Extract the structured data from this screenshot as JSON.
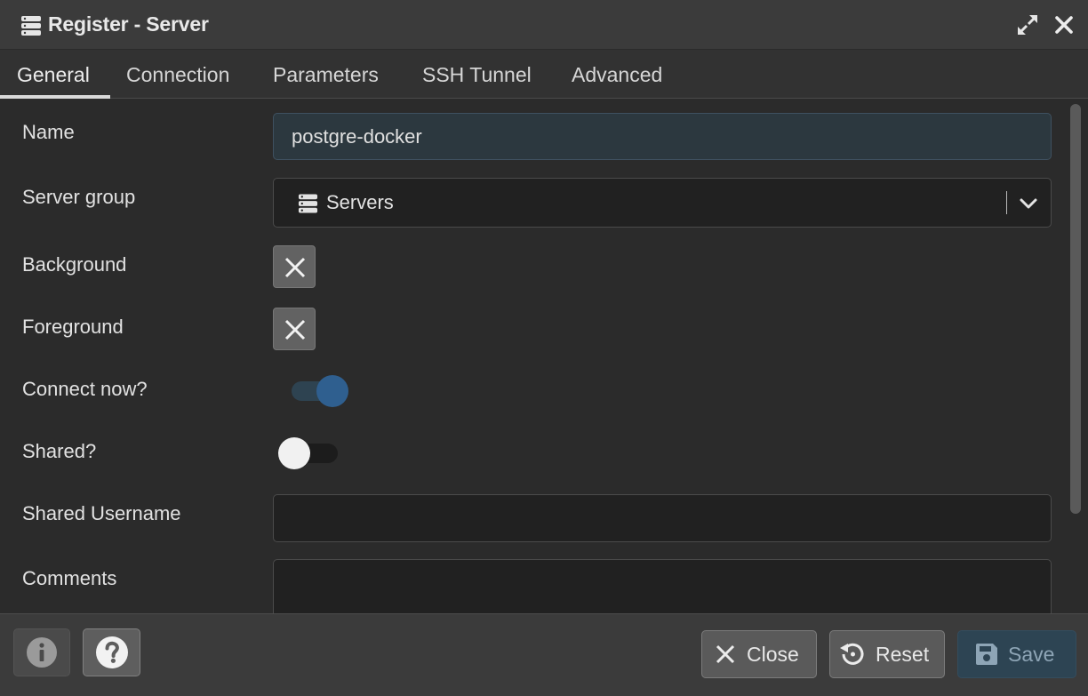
{
  "dialog": {
    "title": "Register - Server"
  },
  "tabs": [
    {
      "label": "General",
      "active": true
    },
    {
      "label": "Connection",
      "active": false
    },
    {
      "label": "Parameters",
      "active": false
    },
    {
      "label": "SSH Tunnel",
      "active": false
    },
    {
      "label": "Advanced",
      "active": false
    }
  ],
  "form": {
    "name_label": "Name",
    "name_value": "postgre-docker",
    "server_group_label": "Server group",
    "server_group_value": "Servers",
    "background_label": "Background",
    "foreground_label": "Foreground",
    "connect_now_label": "Connect now?",
    "connect_now_value": true,
    "shared_label": "Shared?",
    "shared_value": false,
    "shared_username_label": "Shared Username",
    "shared_username_value": "",
    "comments_label": "Comments",
    "comments_value": ""
  },
  "footer": {
    "close_label": "Close",
    "reset_label": "Reset",
    "save_label": "Save"
  },
  "icons": {
    "title": "server-stack-icon",
    "expand": "expand-icon",
    "close": "close-icon",
    "server_group": "server-stack-icon",
    "chevron": "chevron-down-icon",
    "info": "info-icon",
    "help": "help-icon",
    "reset": "reset-icon",
    "save": "floppy-disk-icon"
  },
  "colors": {
    "accent": "#2f5f8f",
    "name_field_bg": "#2c383f",
    "save_button_bg": "#2d4453"
  }
}
